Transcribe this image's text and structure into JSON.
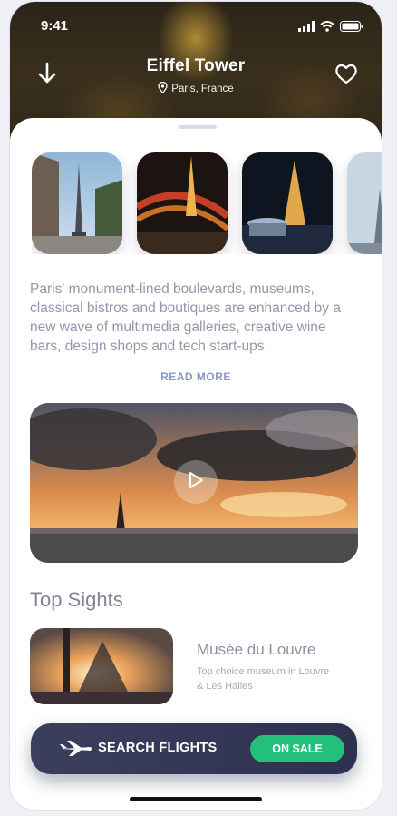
{
  "status": {
    "time": "9:41"
  },
  "header": {
    "title": "Eiffel Tower",
    "location": "Paris, France"
  },
  "description": "Paris' monument-lined boulevards, museums, classical bistros and boutiques are enhanced by a new wave of multimedia galleries, creative wine bars, design shops and tech start-ups.",
  "read_more": "READ MORE",
  "top_sights": {
    "title": "Top Sights",
    "items": [
      {
        "name": "Musée du Louvre",
        "subtitle": "Top choice museum in Louvre & Les Halles"
      }
    ]
  },
  "cta": {
    "label": "SEARCH FLIGHTS",
    "badge": "ON SALE",
    "badge_color": "#22c07a"
  },
  "icons": {
    "back": "arrow-down-icon",
    "favorite": "heart-icon",
    "location": "location-pin-icon",
    "play": "play-icon",
    "plane": "airplane-icon"
  }
}
